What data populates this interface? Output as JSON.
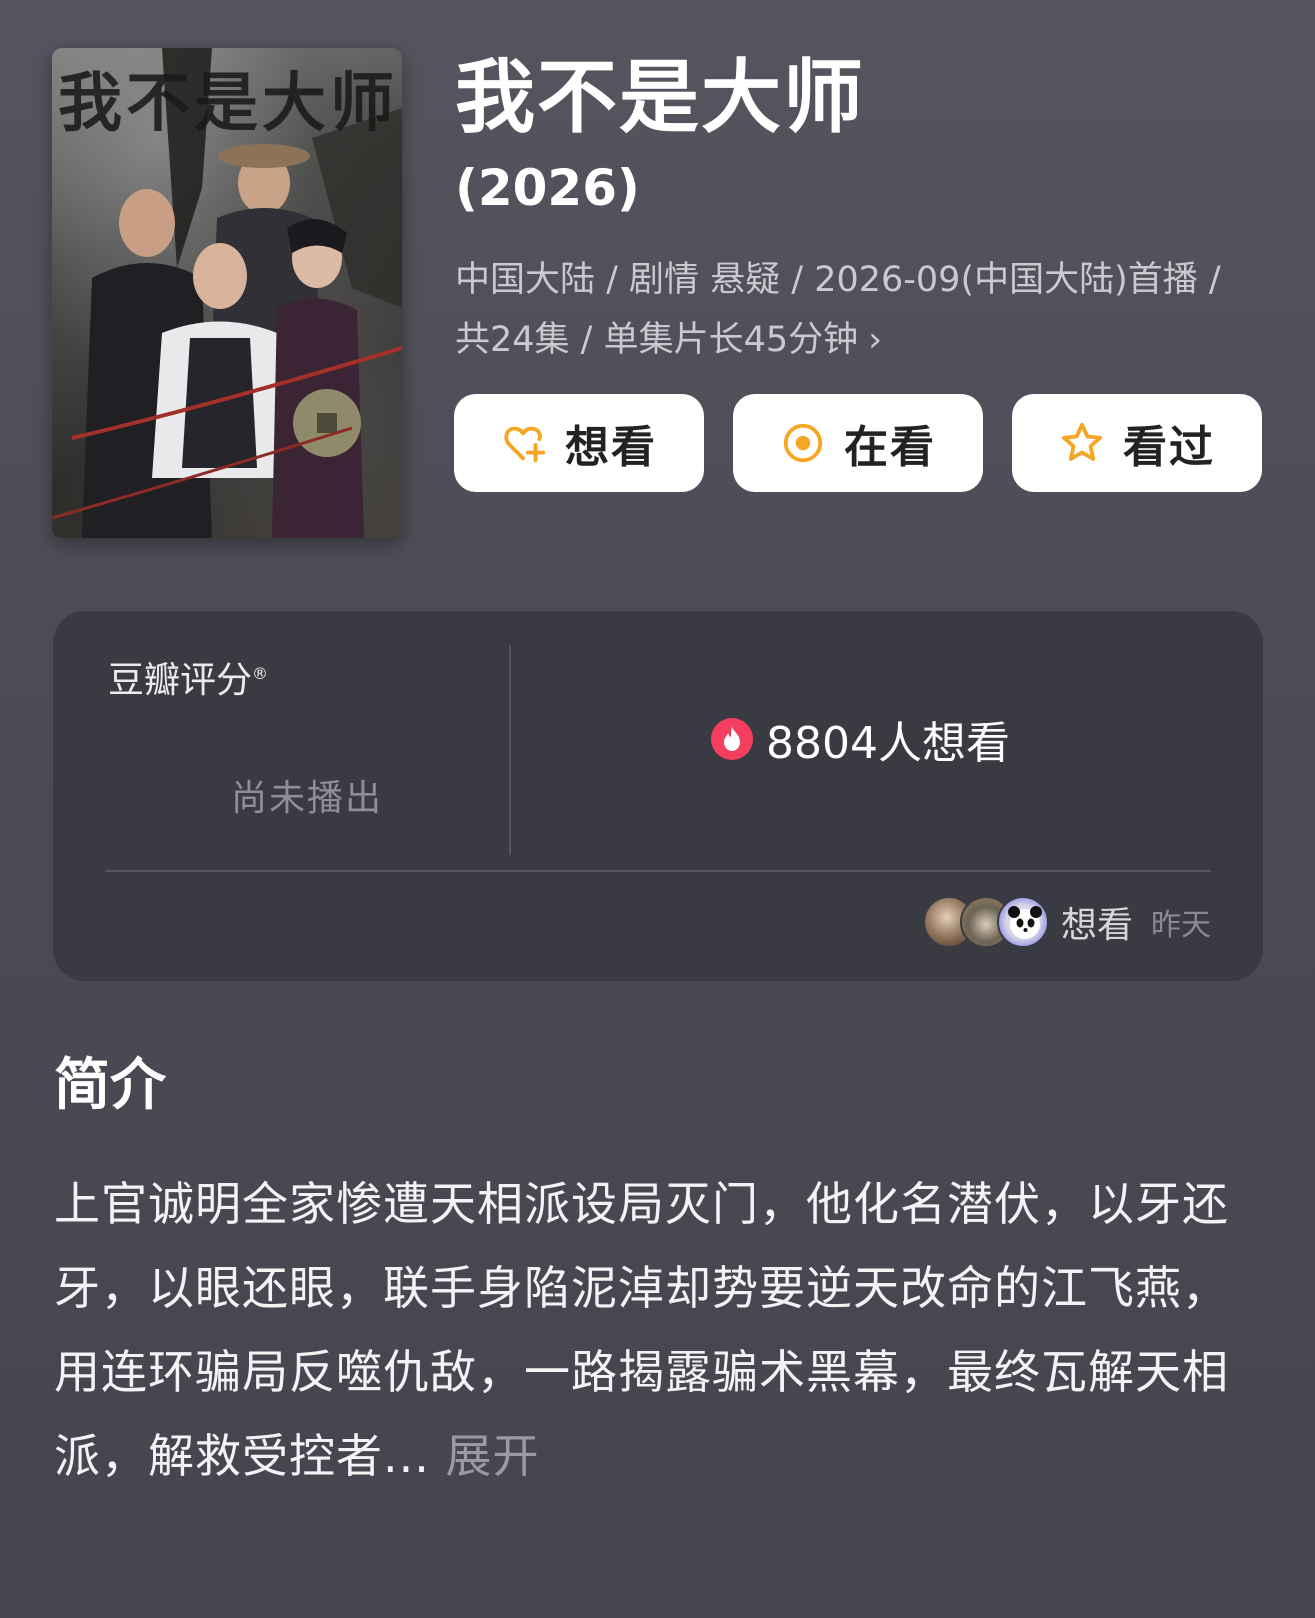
{
  "poster": {
    "title_text": "我不是大师",
    "icon": "poster-image"
  },
  "header": {
    "title": "我不是大师",
    "year": "(2026)",
    "meta": "中国大陆 / 剧情 悬疑 / 2026-09(中国大陆)首播 / 共24集 / 单集片长45分钟",
    "meta_chevron": "›"
  },
  "actions": [
    {
      "label": "想看",
      "icon": "heart-plus-icon"
    },
    {
      "label": "在看",
      "icon": "circle-dot-icon"
    },
    {
      "label": "看过",
      "icon": "star-icon"
    }
  ],
  "colors": {
    "accent": "#f5a623",
    "fire": "#f43f5e",
    "card_bg": "#3a3a42",
    "page_bg": "#4d4d57"
  },
  "rating": {
    "label": "豆瓣评分",
    "registered_mark": "®",
    "status": "尚未播出",
    "wish_count_text": "8804人想看",
    "wish_icon": "fire-icon"
  },
  "activity": {
    "action": "想看",
    "time": "昨天",
    "avatars": [
      "avatar-1",
      "avatar-2",
      "avatar-3"
    ]
  },
  "synopsis": {
    "title": "简介",
    "text": "上官诚明全家惨遭天相派设局灭门，他化名潜伏，以牙还牙，以眼还眼，联手身陷泥淖却势要逆天改命的江飞燕，用连环骗局反噬仇敌，一路揭露骗术黑幕，最终瓦解天相派，解救受控者...",
    "expand": "展开"
  }
}
